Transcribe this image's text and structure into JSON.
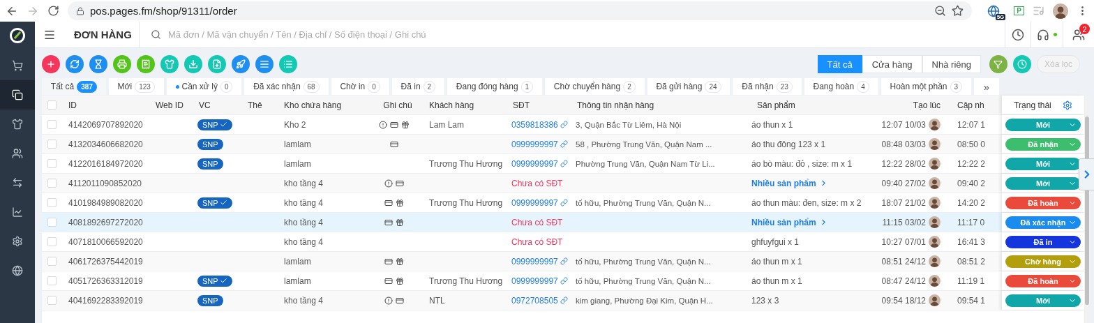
{
  "browser": {
    "url": "pos.pages.fm/shop/91311/order",
    "extensions": [
      {
        "label": "5G"
      },
      {
        "label": "P"
      }
    ]
  },
  "sidebar": {
    "items": [
      {
        "selected": false
      },
      {
        "selected": true
      },
      {
        "selected": false
      },
      {
        "selected": false
      },
      {
        "selected": false
      },
      {
        "selected": false
      },
      {
        "selected": false
      },
      {
        "selected": false
      }
    ]
  },
  "header": {
    "title": "ĐƠN HÀNG",
    "search": {
      "placeholder": "Mã đơn / Mã vận chuyển / Tên / Địa chỉ / Số điện thoại / Ghi chú"
    },
    "online": true,
    "notifications": "2"
  },
  "actions": [
    {
      "color": "#f5365c"
    },
    {
      "color": "#1e8ff0"
    },
    {
      "color": "#1e8ff0"
    },
    {
      "color": "#52c41a"
    },
    {
      "color": "#52c41a"
    },
    {
      "color": "#14c9b4"
    },
    {
      "color": "#14c9b4"
    },
    {
      "color": "#14c9b4"
    },
    {
      "color": "#1e8ff0"
    },
    {
      "color": "#1e8ff0"
    },
    {
      "color": "#14c9b4"
    }
  ],
  "source_filter": [
    {
      "label": "Tất cả",
      "selected": true
    },
    {
      "label": "Cửa hàng",
      "selected": false
    },
    {
      "label": "Nhà riêng",
      "selected": false
    }
  ],
  "clear_filter": {
    "label": "Xóa lọc",
    "disabled": true
  },
  "tabs": [
    {
      "label": "Tất cả",
      "count": "387",
      "selected": true,
      "dot": false
    },
    {
      "label": "Mới",
      "count": "123",
      "selected": false,
      "dot": false
    },
    {
      "label": "Cần xử lý",
      "count": "0",
      "selected": false,
      "dot": true
    },
    {
      "label": "Đã xác nhận",
      "count": "68",
      "selected": false,
      "dot": false
    },
    {
      "label": "Chờ in",
      "count": "0",
      "selected": false,
      "dot": false
    },
    {
      "label": "Đã in",
      "count": "2",
      "selected": false,
      "dot": false
    },
    {
      "label": "Đang đóng hàng",
      "count": "1",
      "selected": false,
      "dot": false
    },
    {
      "label": "Chờ chuyển hàng",
      "count": "2",
      "selected": false,
      "dot": false
    },
    {
      "label": "Đã gửi hàng",
      "count": "24",
      "selected": false,
      "dot": false
    },
    {
      "label": "Đã nhận",
      "count": "23",
      "selected": false,
      "dot": false
    },
    {
      "label": "Đang hoàn",
      "count": "4",
      "selected": false,
      "dot": false
    },
    {
      "label": "Hoàn một phần",
      "count": "3",
      "selected": false,
      "dot": false
    }
  ],
  "more_tabs": "»",
  "table": {
    "all_checked": false,
    "columns": [
      "ID",
      "Web ID",
      "VC",
      "Thẻ",
      "Kho chứa hàng",
      "Ghi chú",
      "Khách hàng",
      "SĐT",
      "Thông tin nhận hàng",
      "Sản phẩm",
      "Tạo lúc",
      "Cập nh",
      "Trạng thái"
    ],
    "rows": [
      {
        "id": "4142069707892020",
        "checked": false,
        "highlighted": false,
        "carrier": {
          "label": "SNP",
          "verified": true
        },
        "warehouse": "Kho 2",
        "notes": [
          {
            "kind": "alert"
          },
          {
            "kind": "card"
          },
          {
            "kind": "gift"
          }
        ],
        "customer": "Lam Lam",
        "phone": {
          "kind": "link",
          "text": "0359818386"
        },
        "address": "3, Quận Bắc Từ Liêm, Hà Nội",
        "product": {
          "kind": "text",
          "text": "áo thun x 1"
        },
        "created": "12:07 10/03",
        "updated": "12:07 1",
        "status": {
          "label": "Mới",
          "color": "#11a6a8"
        }
      },
      {
        "id": "4132034606682020",
        "checked": false,
        "highlighted": false,
        "carrier": {
          "label": "SNP",
          "verified": false
        },
        "warehouse": "lamlam",
        "notes": [
          {
            "kind": "card"
          }
        ],
        "customer": "",
        "phone": {
          "kind": "link",
          "text": "0999999997"
        },
        "address": "58 , Phường Trung Văn, Quận Nam ...",
        "product": {
          "kind": "text",
          "text": "áo thu đông 123 x 1"
        },
        "created": "08:48 03/03",
        "updated": "08:50 0",
        "status": {
          "label": "Đã nhận",
          "color": "#3dbd6e"
        }
      },
      {
        "id": "4122016184972020",
        "checked": false,
        "highlighted": false,
        "carrier": {
          "label": "SNP",
          "verified": false
        },
        "warehouse": "lamlam",
        "notes": [],
        "customer": "Trương Thu Hương",
        "phone": {
          "kind": "link",
          "text": "0999999997"
        },
        "address": "Phường Trung Văn, Quận Nam Từ Li...",
        "product": {
          "kind": "text",
          "text": "áo bò màu: đỏ , size: m x 1"
        },
        "created": "12:22 28/02",
        "updated": "12:22 2",
        "status": {
          "label": "Mới",
          "color": "#11a6a8"
        }
      },
      {
        "id": "4112011090852020",
        "checked": false,
        "highlighted": false,
        "warehouse": "kho tầng 4",
        "notes": [
          {
            "kind": "alert"
          },
          {
            "kind": "card"
          }
        ],
        "customer": "",
        "phone": {
          "kind": "missing",
          "text": "Chưa có SĐT"
        },
        "address": "",
        "product": {
          "kind": "link",
          "text": "Nhiều sản phẩm"
        },
        "created": "09:40 27/02",
        "updated": "09:40 2",
        "status": {
          "label": "Mới",
          "color": "#11a6a8"
        }
      },
      {
        "id": "4101984989082020",
        "checked": false,
        "highlighted": false,
        "carrier": {
          "label": "SNP",
          "verified": true
        },
        "warehouse": "kho tầng 4",
        "notes": [
          {
            "kind": "card"
          },
          {
            "kind": "gift"
          }
        ],
        "customer": "Trương Thu Hương",
        "phone": {
          "kind": "link",
          "text": "0999999997"
        },
        "address": "tố hữu, Phường Trung Văn, Quận N...",
        "product": {
          "kind": "text",
          "text": "áo thun màu: đen, size: m x 2"
        },
        "created": "18:07 21/02",
        "updated": "14:20 2",
        "status": {
          "label": "Đã hoàn",
          "color": "#ea4a3b"
        }
      },
      {
        "id": "4081892697272020",
        "checked": false,
        "highlighted": true,
        "warehouse": "kho tầng 4",
        "notes": [
          {
            "kind": "card"
          },
          {
            "kind": "gift"
          }
        ],
        "customer": "",
        "phone": {
          "kind": "missing",
          "text": "Chưa có SĐT"
        },
        "address": "",
        "product": {
          "kind": "link",
          "text": "Nhiều sản phẩm"
        },
        "created": "11:15 03/02",
        "updated": "11:17 0",
        "status": {
          "label": "Đã xác nhận",
          "color": "#1a8cf0"
        }
      },
      {
        "id": "4071810066592020",
        "checked": false,
        "highlighted": false,
        "warehouse": "kho tầng 4",
        "notes": [],
        "customer": "",
        "phone": {
          "kind": "missing",
          "text": "Chưa có SĐT"
        },
        "address": "",
        "product": {
          "kind": "text",
          "text": "ghfuyfgui x 1"
        },
        "created": "10:27 07/01",
        "updated": "16:41 3",
        "status": {
          "label": "Đã in",
          "color": "#1434dc"
        }
      },
      {
        "id": "4061726375442019",
        "checked": false,
        "highlighted": false,
        "warehouse": "lamlam",
        "notes": [
          {
            "kind": "card"
          },
          {
            "kind": "gift"
          }
        ],
        "customer": "",
        "phone": {
          "kind": "link",
          "text": "0999999997"
        },
        "address": "tố hữu, Phường Trung Văn, Quận N...",
        "product": {
          "kind": "text",
          "text": "áo thun m x 1"
        },
        "created": "08:51 24/12",
        "updated": "08:51 2",
        "status": {
          "label": "Chờ hàng",
          "color": "#b39f0c"
        }
      },
      {
        "id": "4051726363312019",
        "checked": false,
        "highlighted": false,
        "carrier": {
          "label": "SNP",
          "verified": true
        },
        "warehouse": "lamlam",
        "notes": [
          {
            "kind": "card"
          },
          {
            "kind": "gift"
          }
        ],
        "customer": "Trương Thu Hương",
        "phone": {
          "kind": "link",
          "text": "0999999997"
        },
        "address": "tố hữu, Phường Trung Văn, Quận N...",
        "product": {
          "kind": "text",
          "text": "áo thun m x 1"
        },
        "created": "08:47 24/12",
        "updated": "11:19 1",
        "status": {
          "label": "Đã hoàn",
          "color": "#ea4a3b"
        }
      },
      {
        "id": "4041692283392019",
        "checked": false,
        "highlighted": false,
        "carrier": {
          "label": "SNP",
          "verified": false
        },
        "warehouse": "kho tầng 4",
        "notes": [
          {
            "kind": "alert"
          },
          {
            "kind": "card"
          }
        ],
        "customer": "NTL",
        "phone": {
          "kind": "link",
          "text": "0972708505"
        },
        "address": "kim giang, Phường Đại Kim, Quận H...",
        "product": {
          "kind": "text",
          "text": "123 x 3"
        },
        "created": "09:54 18/12",
        "updated": "09:54 1",
        "status": {
          "label": "Mới",
          "color": "#11a6a8"
        }
      }
    ]
  }
}
